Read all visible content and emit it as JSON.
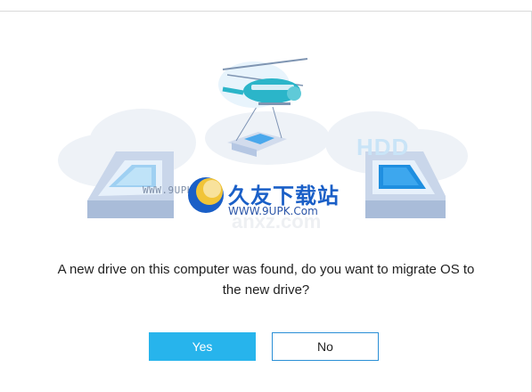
{
  "dialog": {
    "message": "A new drive on this computer was found, do you want to migrate OS to the new drive?",
    "hdd_label": "HDD",
    "buttons": {
      "yes_label": "Yes",
      "no_label": "No"
    }
  },
  "watermark": {
    "left_text": "WWW.9UPK.COM",
    "brand": "久友下载站",
    "url": "WWW.9UPK.Com",
    "faded": "anxz.com"
  },
  "colors": {
    "primary_button": "#27b4ec",
    "secondary_border": "#2a8fd6",
    "accent": "#3fa9e8"
  },
  "icons": [
    "helicopter-icon",
    "drive-left-icon",
    "drive-right-icon",
    "cloud-icon",
    "logo-icon"
  ]
}
